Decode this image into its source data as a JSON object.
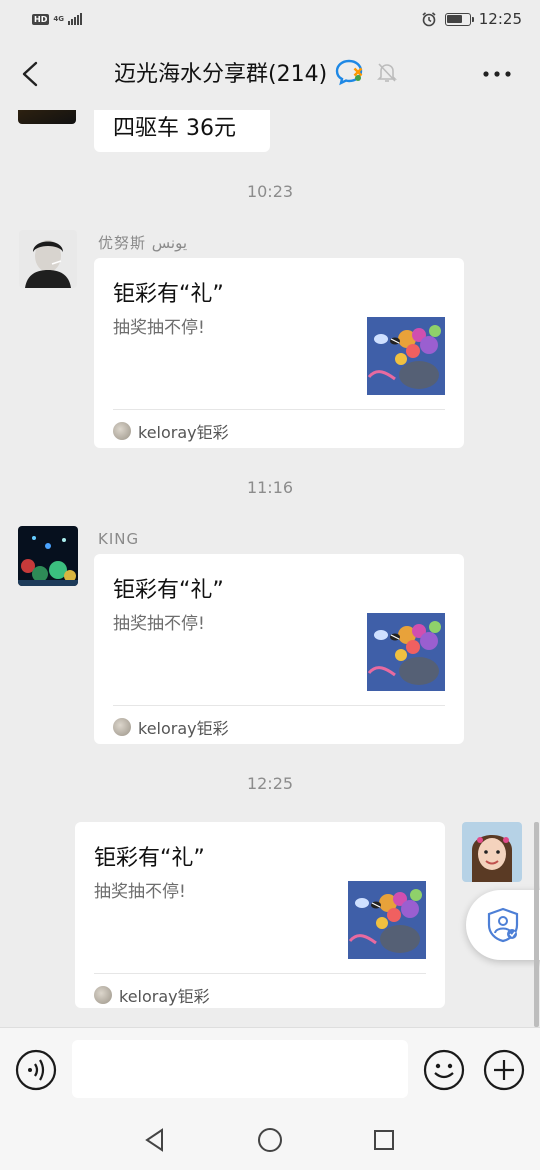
{
  "status_bar": {
    "hd": "HD",
    "network": "4G",
    "time": "12:25"
  },
  "header": {
    "title": "迈光海水分享群(214)"
  },
  "messages": [
    {
      "type": "text",
      "text": "四驱车 36元"
    },
    {
      "type": "timestamp",
      "time": "10:23"
    },
    {
      "type": "card",
      "sender": "优努斯 يونس",
      "title": "钜彩有“礼”",
      "desc": "抽奖抽不停!",
      "source": "keloray钜彩"
    },
    {
      "type": "timestamp",
      "time": "11:16"
    },
    {
      "type": "card",
      "sender": "KING",
      "title": "钜彩有“礼”",
      "desc": "抽奖抽不停!",
      "source": "keloray钜彩"
    },
    {
      "type": "timestamp",
      "time": "12:25"
    },
    {
      "type": "card",
      "sender": "",
      "title": "钜彩有“礼”",
      "desc": "抽奖抽不停!",
      "source": "keloray钜彩"
    }
  ],
  "input": {
    "value": "",
    "placeholder": ""
  },
  "icons": {
    "back": "chevron-left-icon",
    "chat_badge": "group-chat-icon",
    "mute": "bell-off-icon",
    "more": "more-dots-icon",
    "voice": "voice-icon",
    "emoji": "emoji-icon",
    "plus": "plus-icon",
    "shield": "shield-person-icon"
  },
  "colors": {
    "background": "#ededed",
    "bubble": "#ffffff",
    "timestamp_text": "#8c8c8c"
  }
}
